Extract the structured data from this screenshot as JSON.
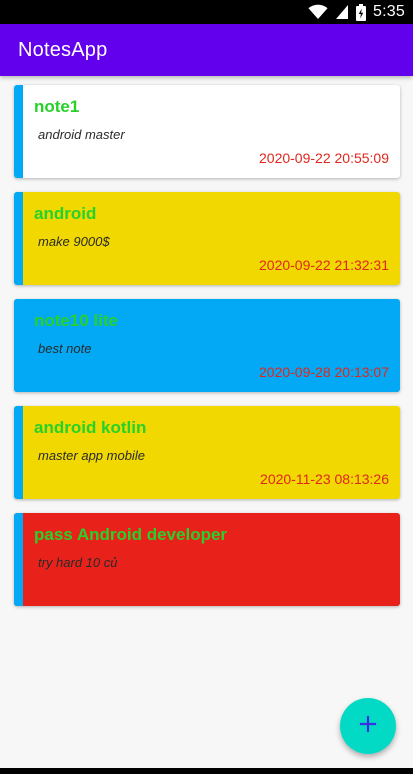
{
  "status_bar": {
    "time": "5:35",
    "icons": [
      "wifi-icon",
      "signal-icon",
      "battery-icon"
    ]
  },
  "app_bar": {
    "title": "NotesApp",
    "color": "#6200ee"
  },
  "notes": [
    {
      "title": "note1",
      "content": "android master",
      "date": "2020-09-22 20:55:09",
      "background": "#ffffff"
    },
    {
      "title": "android",
      "content": "make 9000$",
      "date": "2020-09-22 21:32:31",
      "background": "#f0d800"
    },
    {
      "title": "note10 lite",
      "content": "best note",
      "date": "2020-09-28 20:13:07",
      "background": "#03a9f4"
    },
    {
      "title": "android kotlin",
      "content": "master app mobile",
      "date": "2020-11-23 08:13:26",
      "background": "#f0d800"
    },
    {
      "title": "pass Android developer",
      "content": "try hard 10 củ",
      "date": "",
      "background": "#e8221b"
    }
  ],
  "fab": {
    "icon": "plus-icon",
    "color": "#03dac5"
  },
  "colors": {
    "accent_bar": "#03a9f4",
    "title_text": "#28d12a",
    "date_text": "#e0271d"
  }
}
